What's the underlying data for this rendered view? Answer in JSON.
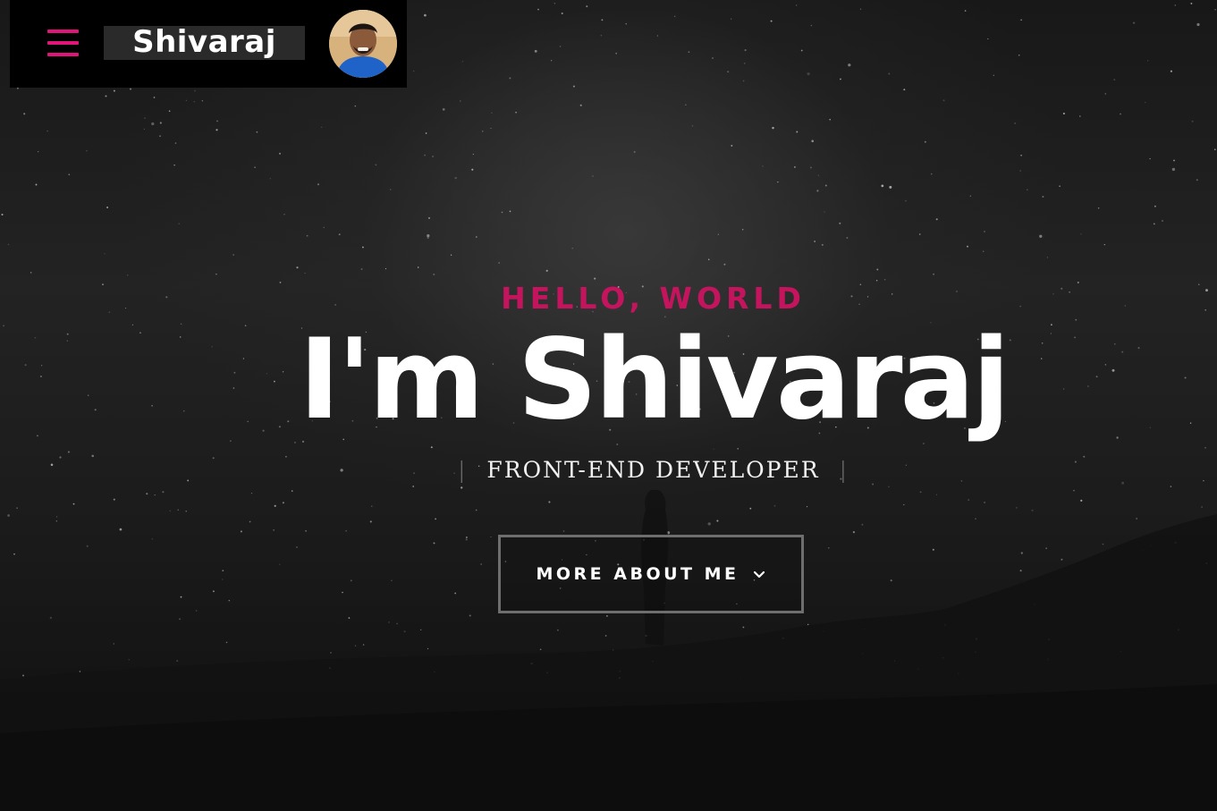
{
  "header": {
    "logo_text": "Shivaraj",
    "menu_icon": "hamburger-menu-icon",
    "avatar_icon": "profile-avatar"
  },
  "hero": {
    "greeting": "HELLO, WORLD",
    "name": "I'm Shivaraj",
    "role": "FRONT-END DEVELOPER",
    "divider_left": "|",
    "divider_right": "|",
    "cta_label": "MORE ABOUT ME",
    "cta_icon": "chevron-down-icon"
  },
  "colors": {
    "accent": "#e0157a",
    "greeting": "#c4145e",
    "text": "#ffffff",
    "topbar": "#000000"
  }
}
